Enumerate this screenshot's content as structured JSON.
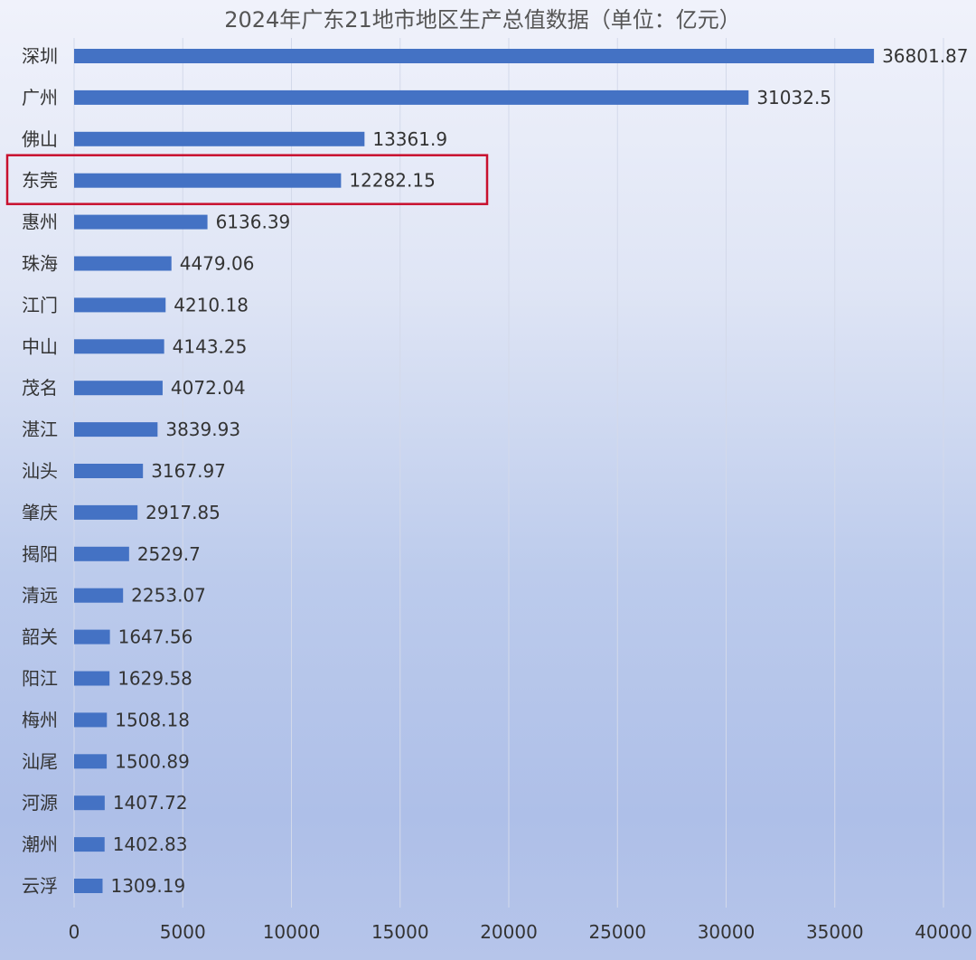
{
  "chart_data": {
    "type": "bar",
    "orientation": "horizontal",
    "title": "2024年广东21地市地区生产总值数据（单位：亿元）",
    "xlabel": "",
    "ylabel": "",
    "categories": [
      "深圳",
      "广州",
      "佛山",
      "东莞",
      "惠州",
      "珠海",
      "江门",
      "中山",
      "茂名",
      "湛江",
      "汕头",
      "肇庆",
      "揭阳",
      "清远",
      "韶关",
      "阳江",
      "梅州",
      "汕尾",
      "河源",
      "潮州",
      "云浮"
    ],
    "values": [
      36801.87,
      31032.5,
      13361.9,
      12282.15,
      6136.39,
      4479.06,
      4210.18,
      4143.25,
      4072.04,
      3839.93,
      3167.97,
      2917.85,
      2529.7,
      2253.07,
      1647.56,
      1629.58,
      1508.18,
      1500.89,
      1407.72,
      1402.83,
      1309.19
    ],
    "value_labels": [
      "36801.87",
      "31032.5",
      "13361.9",
      "12282.15",
      "6136.39",
      "4479.06",
      "4210.18",
      "4143.25",
      "4072.04",
      "3839.93",
      "3167.97",
      "2917.85",
      "2529.7",
      "2253.07",
      "1647.56",
      "1629.58",
      "1508.18",
      "1500.89",
      "1407.72",
      "1402.83",
      "1309.19"
    ],
    "xlim": [
      0,
      40000
    ],
    "xticks": [
      "0",
      "5000",
      "10000",
      "15000",
      "20000",
      "25000",
      "30000",
      "35000",
      "40000"
    ],
    "grid": true,
    "highlight": {
      "category": "东莞",
      "color": "#c8102e"
    },
    "bar_color": "#4472c4"
  }
}
